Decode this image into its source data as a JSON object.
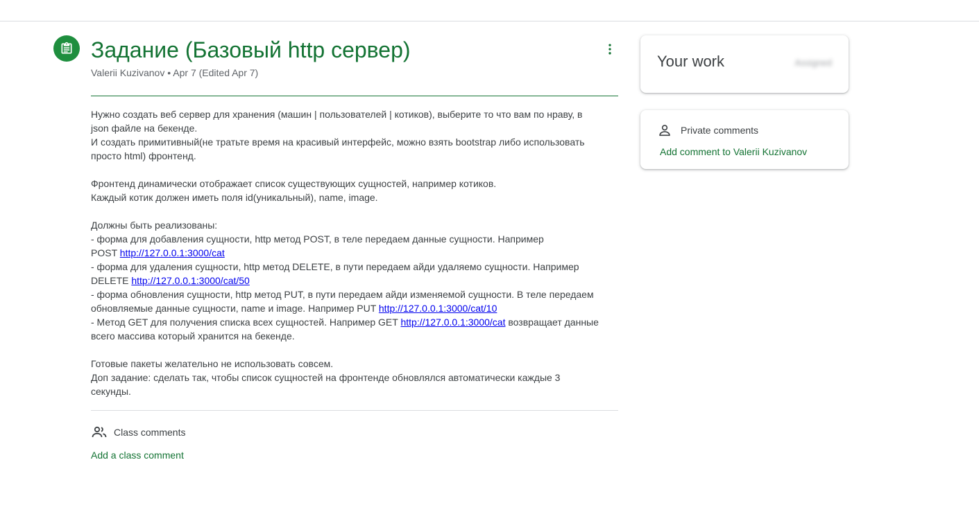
{
  "assignment": {
    "title": "Задание (Базовый http сервер)",
    "author": "Valerii Kuzivanov",
    "date_meta": " • Apr 7 (Edited Apr 7)",
    "accent_color": "#137333"
  },
  "description": {
    "p1_l1": "Нужно создать веб сервер для хранения (машин | пользователей | котиков), выберите то что вам по нраву, в",
    "p1_l2": "json файле на бекенде.",
    "p1_l3": "И создать примитивный(не тратьте время на красивый интерфейс, можно взять bootstrap либо использовать",
    "p1_l4": "просто html) фронтенд.",
    "p2_l1": "Фронтенд динамически отображает список существующих сущностей, например котиков.",
    "p2_l2": "Каждый котик должен иметь поля id(уникальный), name, image.",
    "p3_l1": "Должны быть реализованы:",
    "p3_l2": "- форма для добавления сущности, http метод POST, в теле передаем данные сущности. Например",
    "p3_l3_pre": "POST ",
    "p3_l3_link": "http://127.0.0.1:3000/cat",
    "p3_l4": "- форма для удаления сущности, http метод DELETE, в пути передаем айди удаляемо сущности. Например",
    "p3_l5_pre": "DELETE ",
    "p3_l5_link": "http://127.0.0.1:3000/cat/50",
    "p3_l6": "- форма обновления сущности, http метод PUT, в пути передаем айди изменяемой сущности. В теле передаем",
    "p3_l7_pre": "обновляемые данные сущности, name и image. Например PUT ",
    "p3_l7_link": "http://127.0.0.1:3000/cat/10",
    "p3_l8_pre": "- Метод GET для получения списка всех сущностей. Например GET ",
    "p3_l8_link": "http://127.0.0.1:3000/cat",
    "p3_l8_post": " возвращает данные",
    "p3_l9": "всего массива который хранится на бекенде.",
    "p4_l1": "Готовые пакеты желательно не использовать совсем.",
    "p4_l2": "Доп задание: сделать так, чтобы список сущностей на фронтенде обновлялся автоматически каждые 3",
    "p4_l3": "секунды."
  },
  "class_comments": {
    "label": "Class comments",
    "add_label": "Add a class comment"
  },
  "your_work": {
    "title": "Your work",
    "status": "Assigned"
  },
  "private_comments": {
    "label": "Private comments",
    "add_label": "Add comment to Valerii Kuzivanov"
  },
  "icons": {
    "assignment": "assignment-icon",
    "more": "more-vert-icon",
    "people": "people-icon",
    "person": "person-icon"
  }
}
